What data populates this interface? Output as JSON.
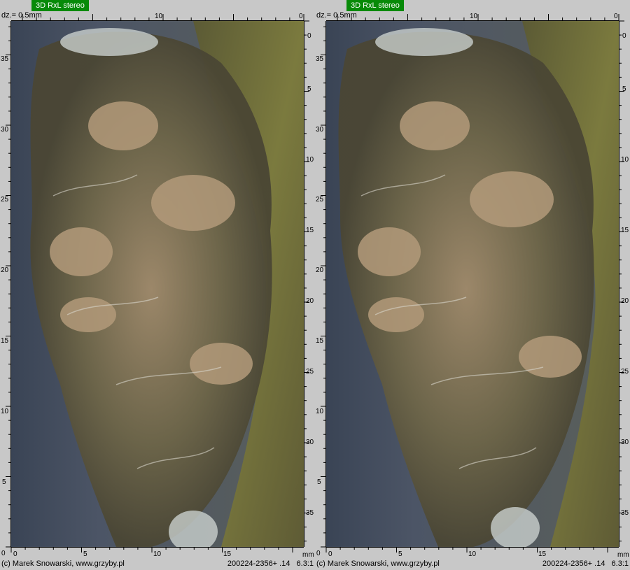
{
  "panels": [
    {
      "badge": "3D RxL stereo",
      "dz": "dz.= 0.5mm",
      "top_ruler_labels": [
        "10",
        "0"
      ],
      "left_ruler_labels": [
        "35",
        "30",
        "25",
        "20",
        "15",
        "10",
        "5",
        "0"
      ],
      "right_ruler_labels": [
        "0",
        "5",
        "10",
        "15",
        "20",
        "25",
        "30",
        "35"
      ],
      "bottom_ruler_labels": [
        "0",
        "5",
        "10",
        "15"
      ],
      "unit": "mm",
      "credit": "(c) Marek Snowarski, www.grzyby.pl",
      "image_id": "200224-2356+ .14",
      "magnification": "6.3:1"
    },
    {
      "badge": "3D RxL stereo",
      "dz": "dz.= 0.5mm",
      "top_ruler_labels": [
        "10",
        "0"
      ],
      "left_ruler_labels": [
        "35",
        "30",
        "25",
        "20",
        "15",
        "10",
        "5",
        "0"
      ],
      "right_ruler_labels": [
        "0",
        "5",
        "10",
        "15",
        "20",
        "25",
        "30",
        "35"
      ],
      "bottom_ruler_labels": [
        "0",
        "5",
        "10",
        "15"
      ],
      "unit": "mm",
      "credit": "(c) Marek Snowarski, www.grzyby.pl",
      "image_id": "200224-2356+ .14",
      "magnification": "6.3:1"
    }
  ],
  "colors": {
    "badge": "#078a08",
    "background": "#c8c8c8",
    "sky": "#3f4a5b",
    "bark": "#6b6a3a",
    "lichen": "#8a7d60"
  }
}
